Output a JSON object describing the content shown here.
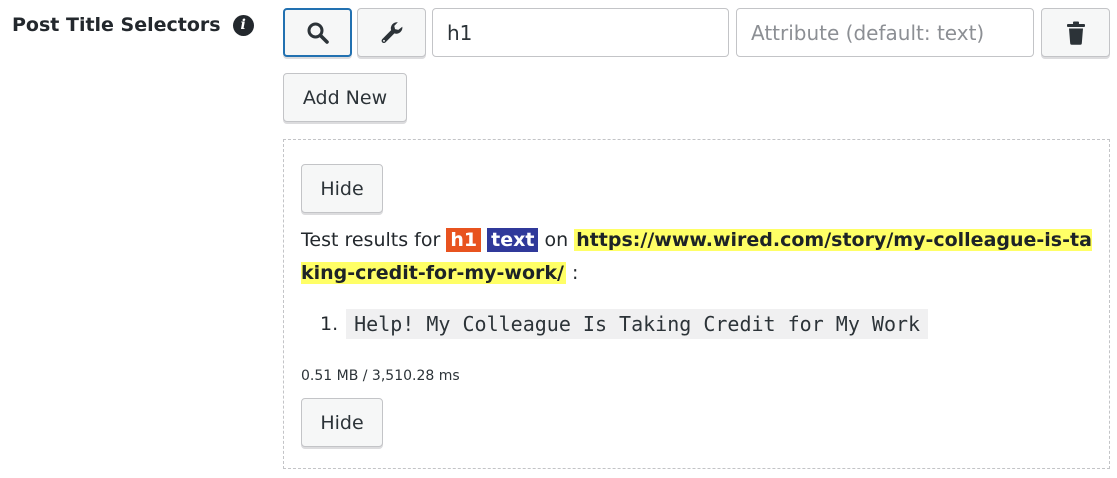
{
  "field": {
    "label": "Post Title Selectors",
    "info_icon": "i"
  },
  "selector_row": {
    "search_icon": "search-icon",
    "wrench_icon": "wrench-icon",
    "trash_icon": "trash-icon",
    "selector_value": "h1",
    "attribute_placeholder": "Attribute (default: text)"
  },
  "add_new_label": "Add New",
  "results": {
    "hide_label": "Hide",
    "prefix": "Test results for",
    "selector_tag": "h1",
    "attribute_tag": "text",
    "on_word": "on",
    "url": "https://www.wired.com/story/my-colleague-is-taking-credit-for-my-work/",
    "suffix": ":",
    "items": [
      {
        "number": "1.",
        "value": "Help! My Colleague Is Taking Credit for My Work"
      }
    ],
    "stats": "0.51 MB / 3,510.28 ms"
  },
  "colors": {
    "accent": "#2271b1",
    "selector_tag_bg": "#e8531f",
    "attribute_tag_bg": "#30399a",
    "url_highlight": "#ffff66"
  }
}
